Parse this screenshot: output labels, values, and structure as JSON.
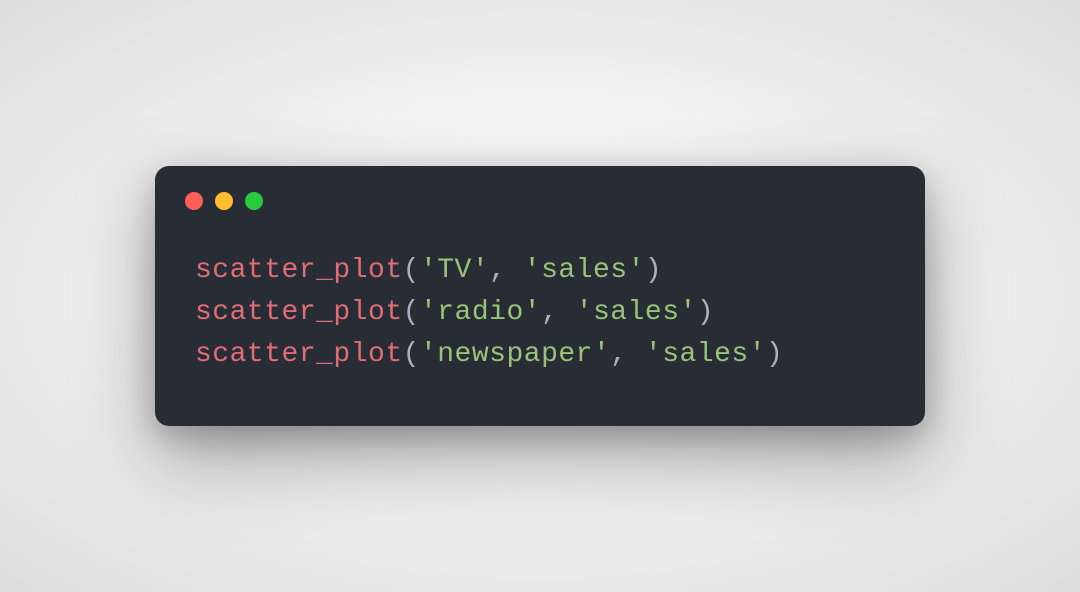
{
  "window": {
    "controls": {
      "close": "close",
      "minimize": "minimize",
      "maximize": "maximize"
    }
  },
  "code": {
    "lines": [
      {
        "func": "scatter_plot",
        "open": "(",
        "arg1": "'TV'",
        "comma": ", ",
        "arg2": "'sales'",
        "close": ")"
      },
      {
        "func": "scatter_plot",
        "open": "(",
        "arg1": "'radio'",
        "comma": ", ",
        "arg2": "'sales'",
        "close": ")"
      },
      {
        "func": "scatter_plot",
        "open": "(",
        "arg1": "'newspaper'",
        "comma": ", ",
        "arg2": "'sales'",
        "close": ")"
      }
    ]
  },
  "colors": {
    "background_window": "#282c34",
    "close": "#ff5f56",
    "minimize": "#ffbd2e",
    "maximize": "#27c93f",
    "func": "#e06c75",
    "string": "#98c379",
    "default": "#abb2bf"
  }
}
